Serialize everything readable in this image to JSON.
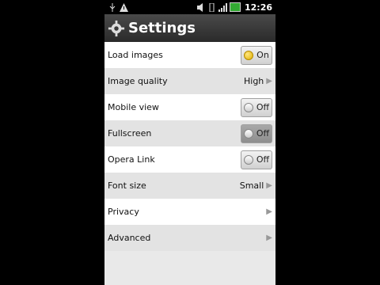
{
  "statusbar": {
    "time": "12:26"
  },
  "header": {
    "title": "Settings"
  },
  "settings": [
    {
      "label": "Load images",
      "type": "toggle",
      "value": "On",
      "state": true
    },
    {
      "label": "Image quality",
      "type": "select",
      "value": "High"
    },
    {
      "label": "Mobile view",
      "type": "toggle",
      "value": "Off",
      "state": false
    },
    {
      "label": "Fullscreen",
      "type": "toggle",
      "value": "Off",
      "state": false
    },
    {
      "label": "Opera Link",
      "type": "toggle",
      "value": "Off",
      "state": false
    },
    {
      "label": "Font size",
      "type": "select",
      "value": "Small"
    },
    {
      "label": "Privacy",
      "type": "nav"
    },
    {
      "label": "Advanced",
      "type": "nav"
    }
  ],
  "icons": [
    "usb-icon",
    "warning-icon",
    "mute-icon",
    "vibrate-icon",
    "signal-icon",
    "battery-icon",
    "gear-icon",
    "chevron-right-icon",
    "radio-dot-icon"
  ],
  "colors": {
    "on_indicator": "#f2c200",
    "row_alt": "#e3e3e3",
    "row": "#ffffff",
    "titlebar": "#3a3a3a"
  }
}
